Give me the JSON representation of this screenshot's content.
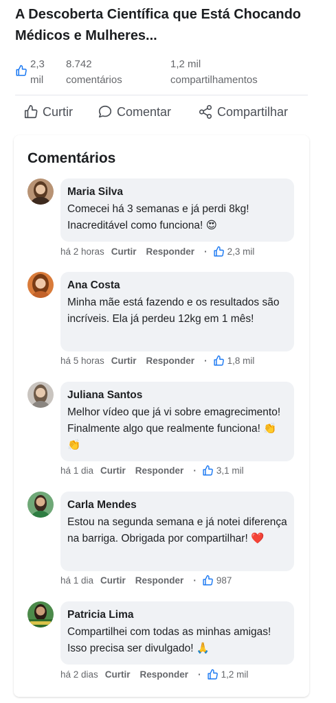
{
  "post": {
    "title": "A Descoberta Científica que Está Chocando Médicos e Mulheres...",
    "likes": "2,3 mil",
    "comments": "8.742 comentários",
    "shares": "1,2 mil compartilhamentos"
  },
  "actions": {
    "like": "Curtir",
    "comment": "Comentar",
    "share": "Compartilhar"
  },
  "comments_section": {
    "title": "Comentários",
    "like_label": "Curtir",
    "reply_label": "Responder",
    "items": [
      {
        "name": "Maria Silva",
        "text": "Comecei há 3 semanas e já perdi 8kg! Inacreditável como funciona! 😍",
        "time": "há 2 horas",
        "likes": "2,3 mil"
      },
      {
        "name": "Ana Costa",
        "text": "Minha mãe está fazendo e os resultados são incríveis. Ela já perdeu 12kg em 1 mês!",
        "time": "há 5 horas",
        "likes": "1,8 mil"
      },
      {
        "name": "Juliana Santos",
        "text": "Melhor vídeo que já vi sobre emagrecimento! Finalmente algo que realmente funciona! 👏👏",
        "time": "há 1 dia",
        "likes": "3,1 mil"
      },
      {
        "name": "Carla Mendes",
        "text": "Estou na segunda semana e já notei diferença na barriga. Obrigada por compartilhar! ❤️",
        "time": "há 1 dia",
        "likes": "987"
      },
      {
        "name": "Patricia Lima",
        "text": "Compartilhei com todas as minhas amigas! Isso precisa ser divulgado! 🙏",
        "time": "há 2 dias",
        "likes": "1,2 mil"
      }
    ]
  },
  "colors": {
    "accent": "#1877f2",
    "text": "#1c1e21",
    "muted": "#65676b",
    "bubble": "#f0f2f5"
  }
}
